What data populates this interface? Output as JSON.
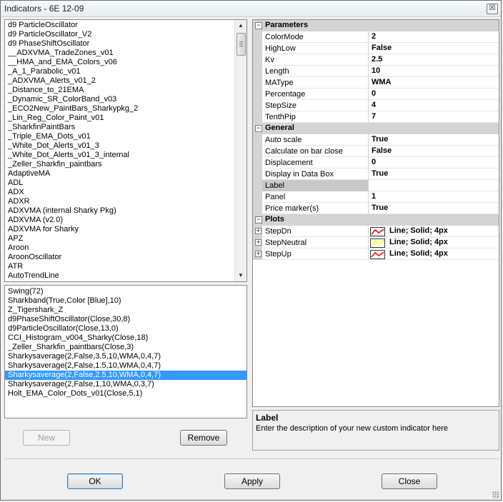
{
  "window": {
    "title": "Indicators - 6E 12-09",
    "close_glyph": "☒"
  },
  "indicator_list": {
    "items": [
      "d9 ParticleOscillator",
      "d9 ParticleOscillator_V2",
      "d9 PhaseShiftOscillator",
      "__ADXVMA_TradeZones_v01",
      "__HMA_and_EMA_Colors_v06",
      "_A_1_Parabolic_v01",
      "_ADXVMA_Alerts_v01_2",
      "_Distance_to_21EMA",
      "_Dynamic_SR_ColorBand_v03",
      "_ECO2New_PaintBars_Sharkypkg_2",
      "_Lin_Reg_Color_Paint_v01",
      "_SharkfinPaintBars",
      "_Triple_EMA_Dots_v01",
      "_White_Dot_Alerts_v01_3",
      "_White_Dot_Alerts_v01_3_internal",
      "_Zeller_Sharkfin_paintbars",
      "AdaptiveMA",
      "ADL",
      "ADX",
      "ADXR",
      "ADXVMA (internal Sharky Pkg)",
      "ADXVMA (v2.0)",
      "ADXVMA for Sharky",
      "APZ",
      "Aroon",
      "AroonOscillator",
      "ATR",
      "AutoTrendLine"
    ],
    "scroll_up": "▲",
    "scroll_down": "▼"
  },
  "applied_list": {
    "items": [
      "Swing(72)",
      "Sharkband(True,Color [Blue],10)",
      "Z_Tigershark_Z",
      "d9PhaseShiftOscillator(Close,30,8)",
      "d9ParticleOscillator(Close,13,0)",
      "CCI_Histogram_v004_Sharky(Close,18)",
      "_Zeller_Sharkfin_paintbars(Close,3)",
      "Sharkysaverage(2,False,3.5,10,WMA,0,4,7)",
      "Sharkysaverage(2,False,1.5,10,WMA,0,4,7)",
      "Sharkysaverage(2,False,2.5,10,WMA,0,4,7)",
      "Sharkysaverage(2,False,1,10,WMA,0,3,7)",
      "Holt_EMA_Color_Dots_v01(Close,5,1)"
    ],
    "selected_index": 9
  },
  "buttons": {
    "new": "New",
    "remove": "Remove",
    "ok": "OK",
    "apply": "Apply",
    "close": "Close"
  },
  "properties": {
    "categories": {
      "parameters": "Parameters",
      "general": "General",
      "plots": "Plots"
    },
    "toggle_glyph": "−",
    "expand_glyph": "+",
    "parameters": [
      {
        "name": "ColorMode",
        "value": "2"
      },
      {
        "name": "HighLow",
        "value": "False"
      },
      {
        "name": "Kv",
        "value": "2.5"
      },
      {
        "name": "Length",
        "value": "10"
      },
      {
        "name": "MAType",
        "value": "WMA"
      },
      {
        "name": "Percentage",
        "value": "0"
      },
      {
        "name": "StepSize",
        "value": "4"
      },
      {
        "name": "TenthPip",
        "value": "7"
      }
    ],
    "general": [
      {
        "name": "Auto scale",
        "value": "True"
      },
      {
        "name": "Calculate on bar close",
        "value": "False"
      },
      {
        "name": "Displacement",
        "value": "0"
      },
      {
        "name": "Display in Data Box",
        "value": "True"
      },
      {
        "name": "Label",
        "value": ""
      },
      {
        "name": "Panel",
        "value": "1"
      },
      {
        "name": "Price marker(s)",
        "value": "True"
      }
    ],
    "plots": [
      {
        "name": "StepDn",
        "value": "Line; Solid; 4px",
        "color": "#ff0000"
      },
      {
        "name": "StepNeutral",
        "value": "Line; Solid; 4px",
        "color": "#ffff00"
      },
      {
        "name": "StepUp",
        "value": "Line; Solid; 4px",
        "color": "#ff0000"
      }
    ]
  },
  "description": {
    "title": "Label",
    "text": "Enter the description of your new custom indicator here"
  }
}
